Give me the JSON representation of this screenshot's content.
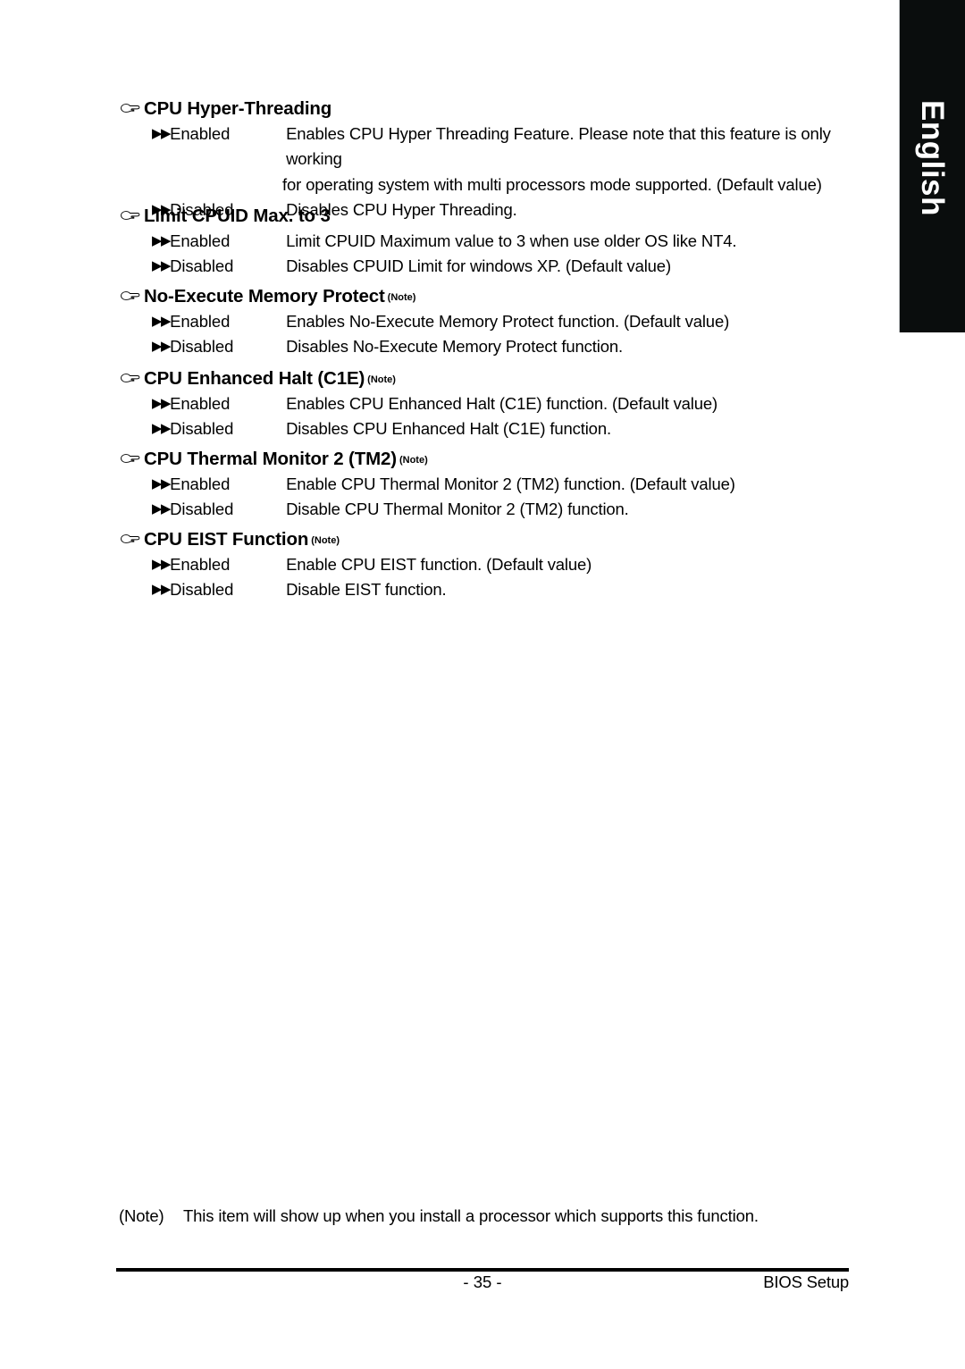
{
  "page": {
    "language_tab": "English",
    "page_number": "- 35 -",
    "section_label": "BIOS Setup"
  },
  "icons": {
    "heading_marker": "pointing-hand-icon",
    "option_marker": "▶▶"
  },
  "footnote": {
    "marker": "(Note)",
    "text": "This item will show up when you install a processor which supports this function."
  },
  "settings": [
    {
      "title": "CPU Hyper-Threading",
      "note": "",
      "options": [
        {
          "label": "Enabled",
          "desc": "Enables CPU Hyper Threading Feature. Please note that this feature is only working",
          "desc_cont": "for operating system with multi processors mode supported. (Default value)"
        },
        {
          "label": "Disabled",
          "desc": "Disables CPU Hyper Threading.",
          "desc_cont": ""
        }
      ]
    },
    {
      "title": "Limit CPUID Max. to 3",
      "note": "",
      "options": [
        {
          "label": "Enabled",
          "desc": "Limit CPUID Maximum value to 3 when use older OS like NT4.",
          "desc_cont": ""
        },
        {
          "label": "Disabled",
          "desc": "Disables CPUID Limit for windows XP. (Default value)",
          "desc_cont": ""
        }
      ]
    },
    {
      "title": "No-Execute Memory Protect",
      "note": "(Note)",
      "options": [
        {
          "label": "Enabled",
          "desc": "Enables No-Execute Memory Protect function. (Default value)",
          "desc_cont": ""
        },
        {
          "label": "Disabled",
          "desc": "Disables No-Execute Memory Protect function.",
          "desc_cont": ""
        }
      ]
    },
    {
      "title": "CPU Enhanced Halt (C1E)",
      "note": "(Note)",
      "options": [
        {
          "label": "Enabled",
          "desc": "Enables CPU Enhanced Halt (C1E) function. (Default value)",
          "desc_cont": ""
        },
        {
          "label": "Disabled",
          "desc": "Disables CPU Enhanced Halt (C1E) function.",
          "desc_cont": ""
        }
      ]
    },
    {
      "title": "CPU Thermal Monitor 2 (TM2)",
      "note": "(Note)",
      "options": [
        {
          "label": "Enabled",
          "desc": "Enable CPU Thermal Monitor 2 (TM2) function. (Default value)",
          "desc_cont": ""
        },
        {
          "label": "Disabled",
          "desc": "Disable CPU Thermal Monitor 2 (TM2) function.",
          "desc_cont": ""
        }
      ]
    },
    {
      "title": "CPU EIST Function",
      "note": "(Note)",
      "options": [
        {
          "label": "Enabled",
          "desc": "Enable CPU EIST function. (Default value)",
          "desc_cont": ""
        },
        {
          "label": "Disabled",
          "desc": "Disable EIST function.",
          "desc_cont": ""
        }
      ]
    }
  ]
}
